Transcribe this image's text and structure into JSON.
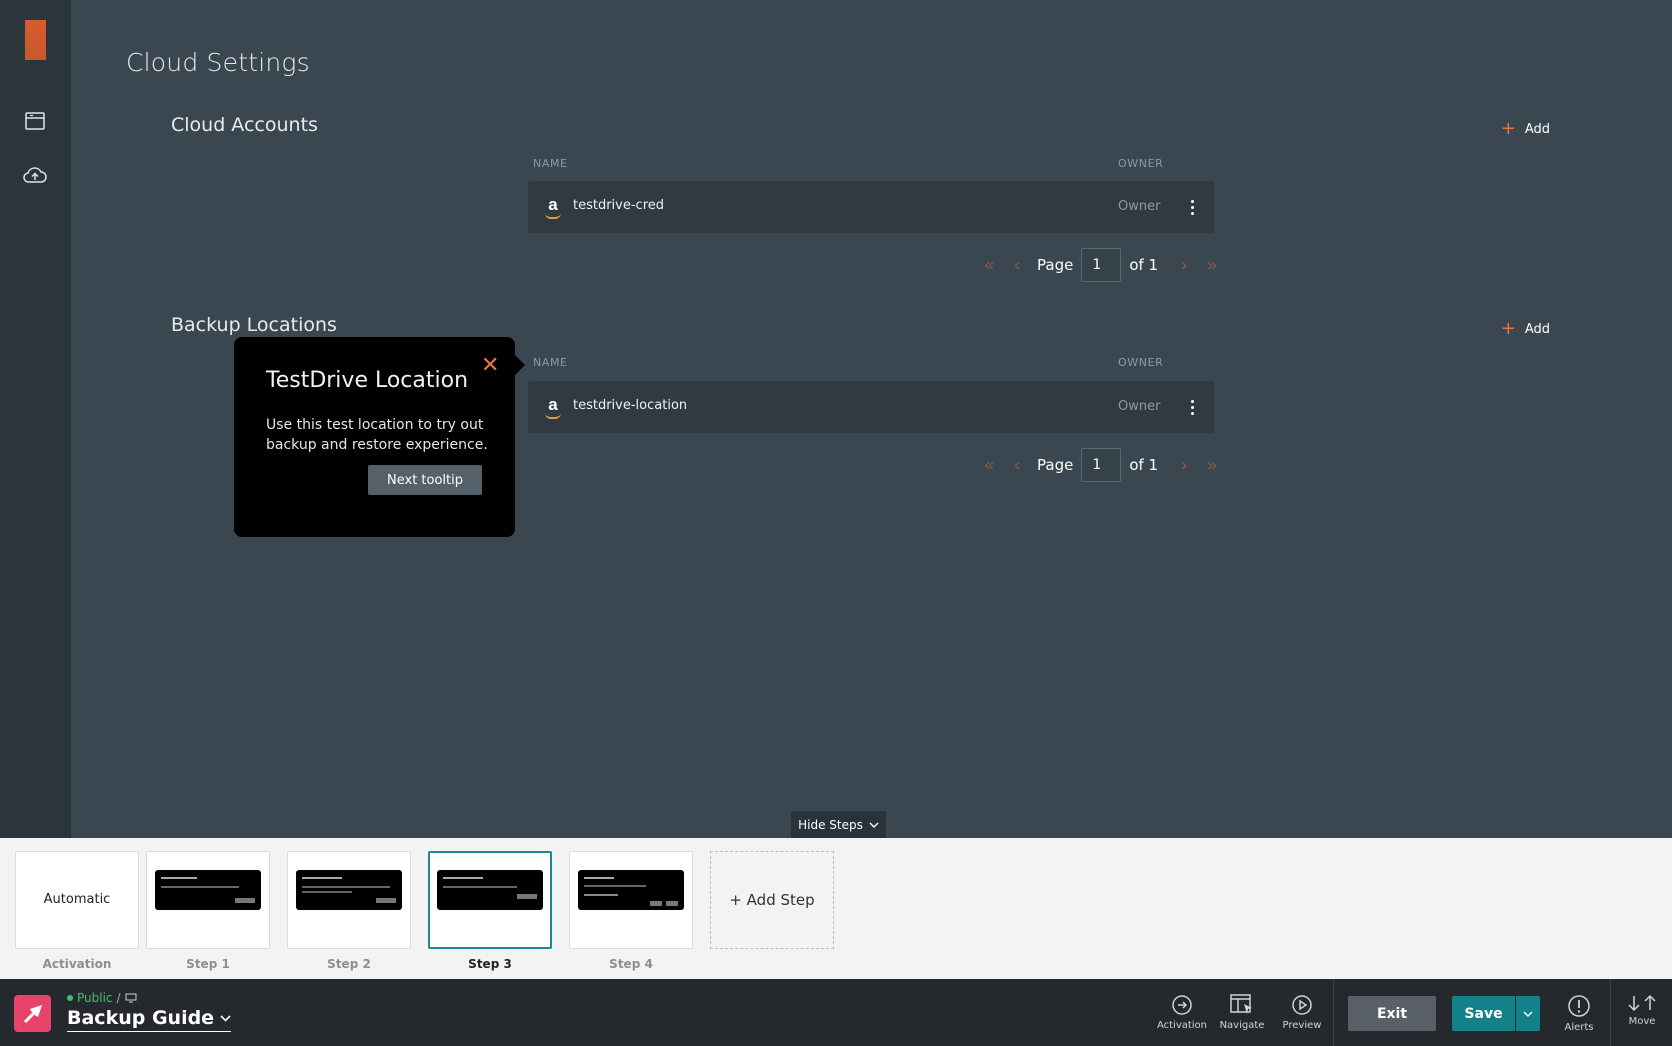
{
  "page": {
    "title": "Cloud Settings"
  },
  "cloud_accounts": {
    "title": "Cloud Accounts",
    "add_label": "Add",
    "columns": {
      "name": "NAME",
      "owner": "OWNER"
    },
    "rows": [
      {
        "name": "testdrive-cred",
        "owner": "Owner"
      }
    ],
    "pager": {
      "page_label": "Page",
      "page": "1",
      "of_label": "of 1"
    }
  },
  "backup_locations": {
    "title": "Backup Locations",
    "add_label": "Add",
    "columns": {
      "name": "NAME",
      "owner": "OWNER"
    },
    "rows": [
      {
        "name": "testdrive-location",
        "owner": "Owner"
      }
    ],
    "pager": {
      "page_label": "Page",
      "page": "1",
      "of_label": "of 1"
    }
  },
  "tooltip": {
    "title": "TestDrive Location",
    "body": "Use this test location to try out backup and restore experience.",
    "button": "Next tooltip"
  },
  "steps": {
    "hide_label": "Hide Steps",
    "activation_card": "Automatic",
    "items": [
      {
        "label": "Activation"
      },
      {
        "label": "Step 1"
      },
      {
        "label": "Step 2"
      },
      {
        "label": "Step 3"
      },
      {
        "label": "Step 4"
      }
    ],
    "add_step": "+ Add Step"
  },
  "toolbar": {
    "visibility": "Public",
    "guide_name": "Backup Guide",
    "activation": "Activation",
    "navigate": "Navigate",
    "preview": "Preview",
    "exit": "Exit",
    "save": "Save",
    "alerts": "Alerts",
    "move": "Move"
  },
  "colors": {
    "accent": "#e8753f",
    "save": "#12828a",
    "brand": "#e8436b"
  }
}
